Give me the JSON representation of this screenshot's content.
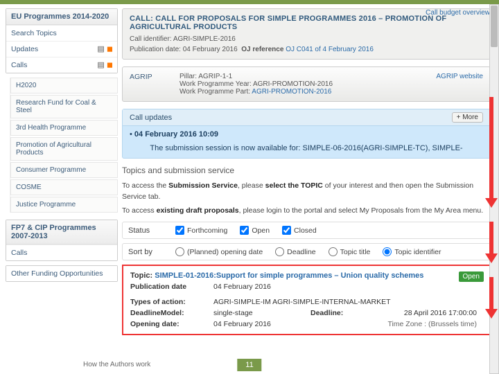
{
  "sidebar": {
    "header": "EU Programmes 2014-2020",
    "items": [
      {
        "label": "Search Topics"
      },
      {
        "label": "Updates"
      },
      {
        "label": "Calls"
      }
    ],
    "calls_children": [
      {
        "label": "H2020"
      },
      {
        "label": "Research Fund for Coal & Steel"
      },
      {
        "label": "3rd Health Programme"
      },
      {
        "label": "Promotion of Agricultural Products"
      },
      {
        "label": "Consumer Programme"
      },
      {
        "label": "COSME"
      },
      {
        "label": "Justice Programme"
      }
    ],
    "fp7_header": "FP7 & CIP Programmes 2007-2013",
    "fp7_item": "Calls",
    "other": "Other Funding Opportunities"
  },
  "call": {
    "budget_link": "Call budget overview",
    "title": "CALL: CALL FOR PROPOSALS FOR SIMPLE PROGRAMMES 2016 – PROMOTION OF AGRICULTURAL PRODUCTS",
    "id_label": "Call identifier:",
    "id_value": "AGRI-SIMPLE-2016",
    "pub_label": "Publication date:",
    "pub_value": "04 February 2016",
    "oj_label": "OJ reference",
    "oj_value": "OJ C041 of 4 February 2016"
  },
  "pillarbox": {
    "left": "AGRIP",
    "website": "AGRIP website",
    "pillar_label": "Pillar:",
    "pillar_value": "AGRIP-1-1",
    "wpy_label": "Work Programme Year:",
    "wpy_value": "AGRI-PROMOTION-2016",
    "wpp_label": "Work Programme Part:",
    "wpp_value": "AGRI-PROMOTION-2016"
  },
  "updates": {
    "header": "Call updates",
    "more": "+ More",
    "date": "04 February 2016 10:09",
    "text": "The submission session is now available for: SIMPLE-06-2016(AGRI-SIMPLE-TC), SIMPLE-"
  },
  "topics_section": {
    "title": "Topics and submission service",
    "line1a": "To access the ",
    "line1b": "Submission Service",
    "line1c": ", please ",
    "line1d": "select the TOPIC",
    "line1e": " of your interest and then open the Submission Service tab.",
    "line2a": "To access ",
    "line2b": "existing draft proposals",
    "line2c": ", please login to the portal and select My Proposals from the My Area menu."
  },
  "filters": {
    "status_label": "Status",
    "forthcoming": "Forthcoming",
    "open": "Open",
    "closed": "Closed",
    "sort_label": "Sort by",
    "opt1": "(Planned) opening date",
    "opt2": "Deadline",
    "opt3": "Topic title",
    "opt4": "Topic identifier"
  },
  "topic": {
    "label": "Topic:",
    "title": "SIMPLE-01-2016:Support for simple programmes – Union quality schemes",
    "badge": "Open",
    "pub_label": "Publication date",
    "pub_value": "04 February 2016",
    "types_label": "Types of action:",
    "types_value": "AGRI-SIMPLE-IM AGRI-SIMPLE-INTERNAL-MARKET",
    "dm_label": "DeadlineModel:",
    "dm_value": "single-stage",
    "open_label": "Opening date:",
    "open_value": "04 February 2016",
    "deadline_label": "Deadline:",
    "deadline_value": "28 April 2016 17:00:00",
    "tz": "Time Zone : (Brussels time)"
  },
  "footer": {
    "label": "How the Authors work"
  },
  "pagenum": "11"
}
